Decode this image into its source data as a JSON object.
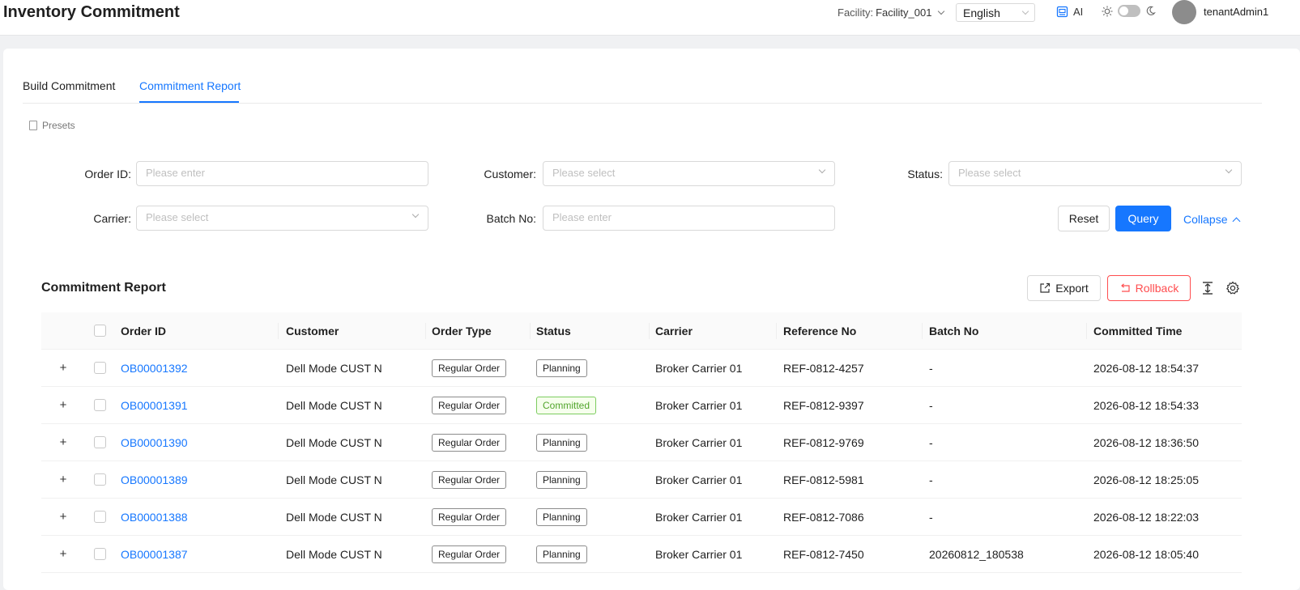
{
  "header": {
    "title": "Inventory Commitment",
    "facility_label": "Facility:",
    "facility_value": "Facility_001",
    "language": "English",
    "ai_label": "AI",
    "username": "tenantAdmin1"
  },
  "tabs": [
    {
      "label": "Build Commitment",
      "active": false
    },
    {
      "label": "Commitment Report",
      "active": true
    }
  ],
  "presets_label": "Presets",
  "filters": {
    "order_id": {
      "label": "Order ID",
      "placeholder": "Please enter"
    },
    "customer": {
      "label": "Customer",
      "placeholder": "Please select"
    },
    "status": {
      "label": "Status",
      "placeholder": "Please select"
    },
    "carrier": {
      "label": "Carrier",
      "placeholder": "Please select"
    },
    "batch_no": {
      "label": "Batch No",
      "placeholder": "Please enter"
    },
    "reset": "Reset",
    "query": "Query",
    "collapse": "Collapse"
  },
  "report": {
    "title": "Commitment Report",
    "export": "Export",
    "rollback": "Rollback"
  },
  "table": {
    "columns": [
      "Order ID",
      "Customer",
      "Order Type",
      "Status",
      "Carrier",
      "Reference No",
      "Batch No",
      "Committed Time"
    ],
    "rows": [
      {
        "order_id": "OB00001392",
        "customer": "Dell Mode CUST N",
        "order_type": "Regular Order",
        "status": "Planning",
        "carrier": "Broker Carrier 01",
        "reference": "REF-0812-4257",
        "batch": "-",
        "time": "2026-08-12 18:54:37"
      },
      {
        "order_id": "OB00001391",
        "customer": "Dell Mode CUST N",
        "order_type": "Regular Order",
        "status": "Committed",
        "carrier": "Broker Carrier 01",
        "reference": "REF-0812-9397",
        "batch": "-",
        "time": "2026-08-12 18:54:33"
      },
      {
        "order_id": "OB00001390",
        "customer": "Dell Mode CUST N",
        "order_type": "Regular Order",
        "status": "Planning",
        "carrier": "Broker Carrier 01",
        "reference": "REF-0812-9769",
        "batch": "-",
        "time": "2026-08-12 18:36:50"
      },
      {
        "order_id": "OB00001389",
        "customer": "Dell Mode CUST N",
        "order_type": "Regular Order",
        "status": "Planning",
        "carrier": "Broker Carrier 01",
        "reference": "REF-0812-5981",
        "batch": "-",
        "time": "2026-08-12 18:25:05"
      },
      {
        "order_id": "OB00001388",
        "customer": "Dell Mode CUST N",
        "order_type": "Regular Order",
        "status": "Planning",
        "carrier": "Broker Carrier 01",
        "reference": "REF-0812-7086",
        "batch": "-",
        "time": "2026-08-12 18:22:03"
      },
      {
        "order_id": "OB00001387",
        "customer": "Dell Mode CUST N",
        "order_type": "Regular Order",
        "status": "Planning",
        "carrier": "Broker Carrier 01",
        "reference": "REF-0812-7450",
        "batch": "20260812_180538",
        "time": "2026-08-12 18:05:40"
      }
    ]
  },
  "colors": {
    "primary": "#1677ff",
    "danger": "#ff4d4f",
    "success": "#52a52c"
  }
}
